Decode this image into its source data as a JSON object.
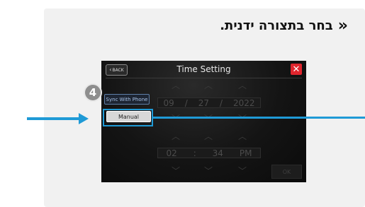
{
  "instruction": {
    "text": "בחר בתצורה ידנית.",
    "chevron": "«"
  },
  "screen": {
    "back_label": "BACK",
    "back_icon": "chevron-left-icon",
    "title": "Time Setting",
    "close_icon": "close-icon",
    "close_symbol": "✕",
    "sync_label": "Sync With Phone",
    "manual_label": "Manual",
    "date": {
      "month": "09",
      "day": "27",
      "year": "2022",
      "sep": "/"
    },
    "time": {
      "hour": "02",
      "minute": "34",
      "ampm": "PM",
      "sep": ":"
    },
    "ok_label": "OK"
  },
  "step_badge": "4",
  "colors": {
    "accent_blue": "#1f9ad6",
    "close_red": "#e0262e",
    "screen_bg": "#121212"
  }
}
